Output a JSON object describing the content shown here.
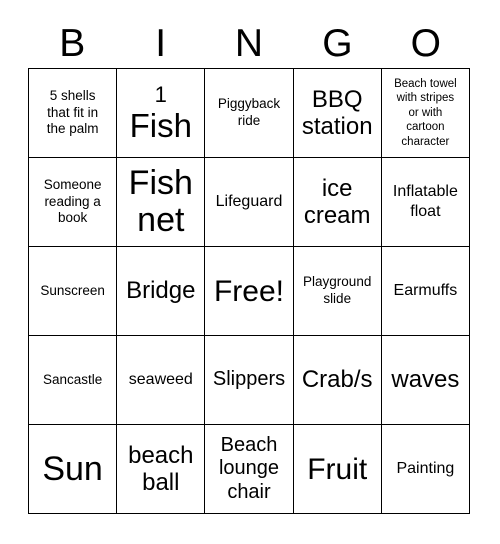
{
  "card": {
    "header_letters": [
      "B",
      "I",
      "N",
      "G",
      "O"
    ],
    "free_space_label": "Free!",
    "cells": [
      {
        "id": "b1",
        "text": "5 shells\nthat fit in\nthe palm",
        "size": "fs-sm"
      },
      {
        "id": "i1",
        "text": "1 Fish",
        "size": "mixed",
        "line_small": "1",
        "line_big": "Fish"
      },
      {
        "id": "n1",
        "text": "Piggyback\nride",
        "size": "fs-sm"
      },
      {
        "id": "g1",
        "text": "BBQ\nstation",
        "size": "fs-xl"
      },
      {
        "id": "o1",
        "text": "Beach towel\nwith stripes\nor with\ncartoon\ncharacter",
        "size": "fs-xs"
      },
      {
        "id": "b2",
        "text": "Someone\nreading a\nbook",
        "size": "fs-sm"
      },
      {
        "id": "i2",
        "text": "Fish\nnet",
        "size": "fs-huge"
      },
      {
        "id": "n2",
        "text": "Lifeguard",
        "size": "fs-md"
      },
      {
        "id": "g2",
        "text": "ice\ncream",
        "size": "fs-xl"
      },
      {
        "id": "o2",
        "text": "Inflatable\nfloat",
        "size": "fs-md"
      },
      {
        "id": "b3",
        "text": "Sunscreen",
        "size": "fs-sm"
      },
      {
        "id": "i3",
        "text": "Bridge",
        "size": "fs-xl"
      },
      {
        "id": "n3",
        "text": "Free!",
        "size": "fs-xxl"
      },
      {
        "id": "g3",
        "text": "Playground\nslide",
        "size": "fs-sm"
      },
      {
        "id": "o3",
        "text": "Earmuffs",
        "size": "fs-md"
      },
      {
        "id": "b4",
        "text": "Sancastle",
        "size": "fs-sm"
      },
      {
        "id": "i4",
        "text": "seaweed",
        "size": "fs-md"
      },
      {
        "id": "n4",
        "text": "Slippers",
        "size": "fs-lg"
      },
      {
        "id": "g4",
        "text": "Crab/s",
        "size": "fs-xl"
      },
      {
        "id": "o4",
        "text": "waves",
        "size": "fs-xl"
      },
      {
        "id": "b5",
        "text": "Sun",
        "size": "fs-huge"
      },
      {
        "id": "i5",
        "text": "beach\nball",
        "size": "fs-xl"
      },
      {
        "id": "n5",
        "text": "Beach\nlounge\nchair",
        "size": "fs-lg"
      },
      {
        "id": "g5",
        "text": "Fruit",
        "size": "fs-xxl"
      },
      {
        "id": "o5",
        "text": "Painting",
        "size": "fs-md"
      }
    ]
  },
  "colors": {
    "background": "#ffffff",
    "text": "#000000",
    "grid_line": "#000000"
  }
}
